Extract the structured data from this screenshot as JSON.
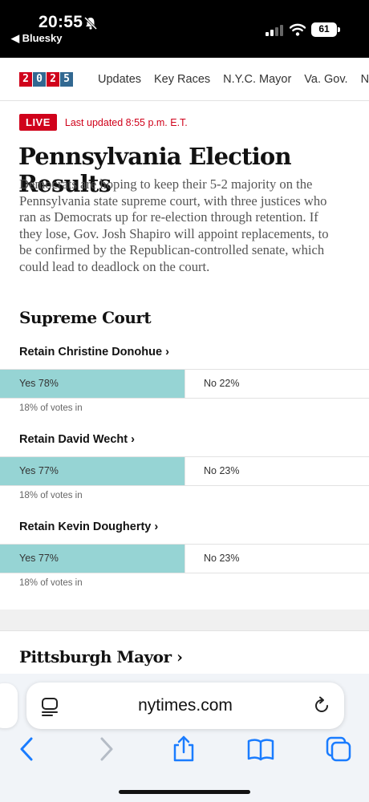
{
  "status_bar": {
    "time": "20:55",
    "back_app": "◀ Bluesky",
    "battery": "61",
    "icons": [
      "bell-slash-icon",
      "cellular-signal-icon",
      "wifi-icon",
      "battery-icon"
    ]
  },
  "nav": {
    "logo_digits": [
      "2",
      "0",
      "2",
      "5"
    ],
    "items": [
      "Updates",
      "Key Races",
      "N.Y.C. Mayor",
      "Va. Gov.",
      "N."
    ]
  },
  "live": {
    "badge": "LIVE",
    "updated": "Last updated 8:55 p.m. E.T."
  },
  "headline": "Pennsylvania Election Results",
  "summary": "Democrats are hoping to keep their 5-2 majority on the Pennsylvania state supreme court, with three justices who ran as Democrats up for re-election through retention. If they lose, Gov. Josh Shapiro will appoint replacements, to be confirmed by the Republican-controlled senate, which could lead to deadlock on the court.",
  "section_title": "Supreme Court",
  "races": [
    {
      "title": "Retain Christine Donohue ›",
      "yes_label": "Yes 78%",
      "no_label": "No 22%",
      "yes_fraction": 0.5,
      "votes_in": "18% of votes in"
    },
    {
      "title": "Retain David Wecht ›",
      "yes_label": "Yes 77%",
      "no_label": "No 23%",
      "yes_fraction": 0.5,
      "votes_in": "18% of votes in"
    },
    {
      "title": "Retain Kevin Dougherty ›",
      "yes_label": "Yes 77%",
      "no_label": "No 23%",
      "yes_fraction": 0.5,
      "votes_in": "18% of votes in"
    }
  ],
  "next_section_title": "Pittsburgh Mayor ›",
  "browser": {
    "url": "nytimes.com",
    "icons": [
      "reader-icon",
      "reload-icon",
      "back-arrow-icon",
      "forward-arrow-icon",
      "share-icon",
      "bookmarks-icon",
      "tabs-icon"
    ]
  },
  "colors": {
    "accent_red": "#d0021b",
    "yes_bar": "#96d4d4",
    "logo_blue": "#326891"
  }
}
